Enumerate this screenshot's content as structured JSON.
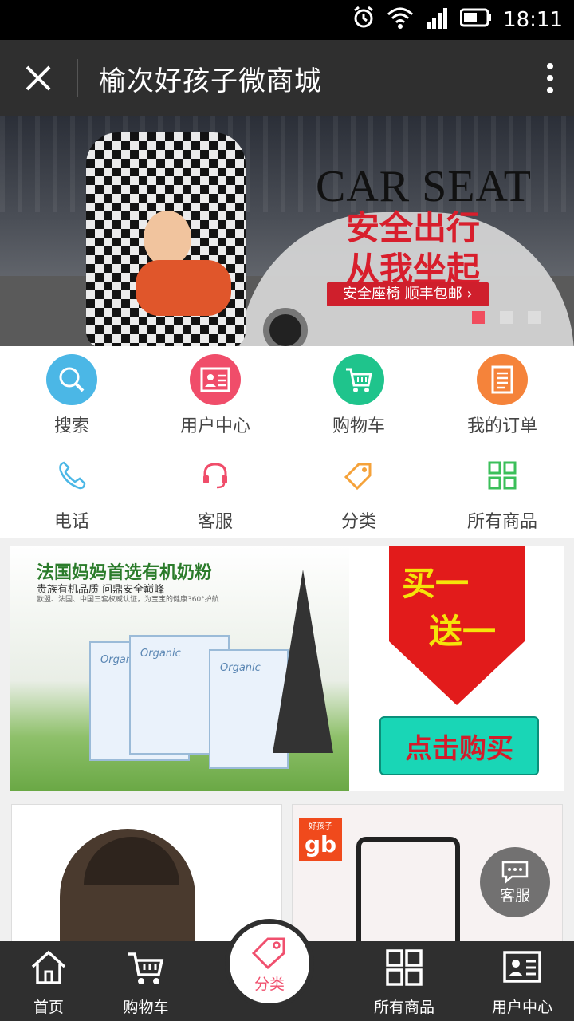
{
  "status_bar": {
    "time": "18:11",
    "icons": [
      "alarm-icon",
      "wifi-icon",
      "signal-icon",
      "battery-icon"
    ]
  },
  "header": {
    "title": "榆次好孩子微商城",
    "close_icon": "close-icon",
    "more_icon": "more-vertical-icon"
  },
  "banner": {
    "headline_en": "CAR SEAT",
    "line1": "安全出行",
    "line2": "从我坐起",
    "tag": "安全座椅 顺丰包邮 ›",
    "dots": 3,
    "active_dot": 0,
    "accent": "#f04d5e"
  },
  "menu": {
    "row1": [
      {
        "label": "搜索",
        "icon": "search-icon",
        "color": "#4bb7e6"
      },
      {
        "label": "用户中心",
        "icon": "user-card-icon",
        "color": "#f04d6a"
      },
      {
        "label": "购物车",
        "icon": "cart-icon",
        "color": "#1fc48c"
      },
      {
        "label": "我的订单",
        "icon": "order-list-icon",
        "color": "#f5833a"
      }
    ],
    "row2": [
      {
        "label": "电话",
        "icon": "phone-icon",
        "color": "#4bb7e6"
      },
      {
        "label": "客服",
        "icon": "headset-icon",
        "color": "#f04d6a"
      },
      {
        "label": "分类",
        "icon": "tag-icon",
        "color": "#f5a23a"
      },
      {
        "label": "所有商品",
        "icon": "grid-icon",
        "color": "#3bbf5a"
      }
    ]
  },
  "promo": {
    "title": "法国妈妈首选有机奶粉",
    "subtitle": "贵族有机品质 问鼎安全巅峰",
    "small": "欧盟、法国、中国三套权威认证，为宝宝的健康360°护航",
    "box_brand": "Organic",
    "offer_top": "买一",
    "offer_bottom": "送一",
    "buy_button": "点击购买"
  },
  "cards": [
    {
      "name": "stroller-1"
    },
    {
      "name": "stroller-2",
      "badge": "gb",
      "badge_top": "好孩子"
    }
  ],
  "float_button": {
    "label": "客服",
    "icon": "chat-bubble-icon"
  },
  "tabbar": {
    "items": [
      {
        "label": "首页",
        "icon": "home-icon"
      },
      {
        "label": "购物车",
        "icon": "cart-icon"
      },
      {
        "label": "分类",
        "icon": "tag-icon",
        "active": true
      },
      {
        "label": "所有商品",
        "icon": "grid-icon"
      },
      {
        "label": "用户中心",
        "icon": "user-card-icon"
      }
    ],
    "active_color": "#f0506e"
  }
}
